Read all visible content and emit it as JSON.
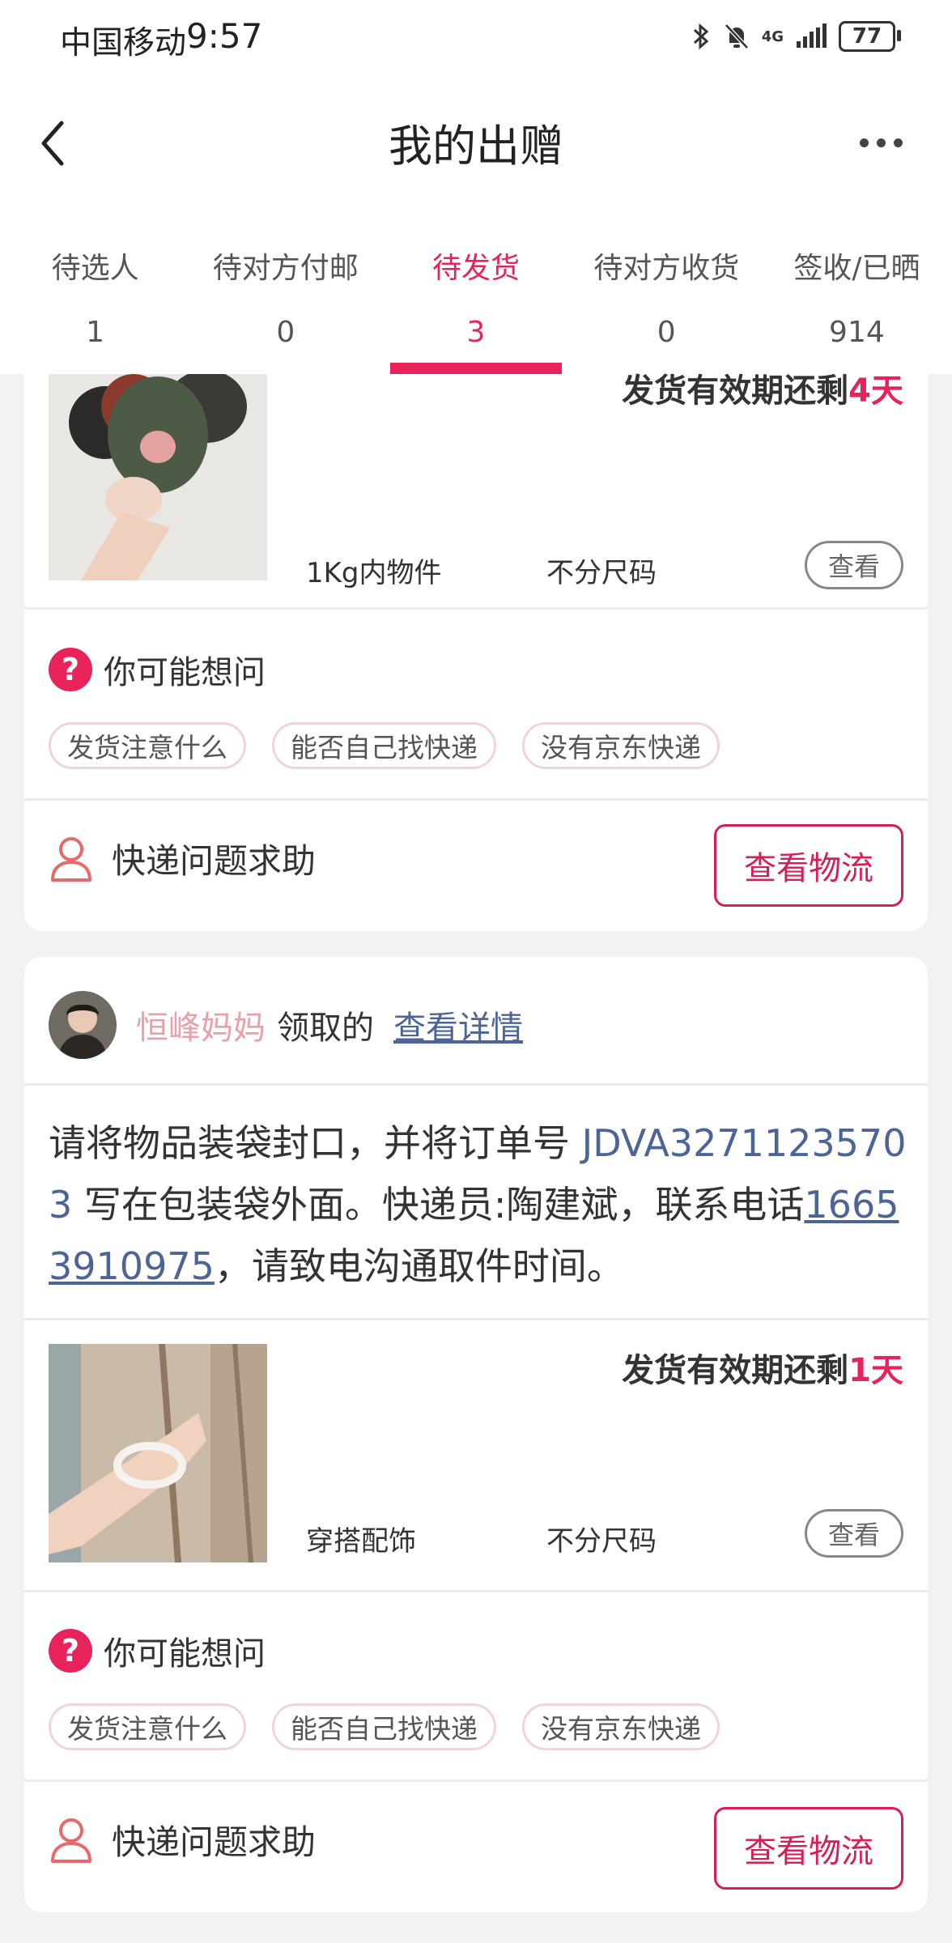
{
  "status_bar": {
    "carrier": "中国移动",
    "time": "9:57",
    "network": "4G",
    "battery": "77",
    "icons": [
      "bluetooth-icon",
      "bell-off-icon",
      "signal-icon",
      "battery-icon"
    ]
  },
  "header": {
    "title": "我的出赠",
    "back_icon": "chevron-left-icon",
    "more_icon": "more-horizontal-icon"
  },
  "tabs": [
    {
      "label": "待选人",
      "count": "1"
    },
    {
      "label": "待对方付邮",
      "count": "0"
    },
    {
      "label": "待发货",
      "count": "3",
      "active": true
    },
    {
      "label": "待对方收货",
      "count": "0"
    },
    {
      "label": "签收/已晒",
      "count": "914"
    }
  ],
  "card1": {
    "deadline_prefix": "发货有效期还剩",
    "deadline_days": "4天",
    "category": "1Kg内物件",
    "size": "不分尺码",
    "view_label": "查看",
    "faq_title": "你可能想问",
    "faq_chips": [
      "发货注意什么",
      "能否自己找快递",
      "没有京东快递"
    ],
    "help_label": "快递问题求助",
    "logistics_label": "查看物流"
  },
  "card2": {
    "recipient_name": "恒峰妈妈",
    "recipient_action": "领取的",
    "detail_link": "查看详情",
    "instr_part1": "请将物品装袋封口，并将订单号 ",
    "order_no": "JDVA32711235703",
    "instr_part2": " 写在包装袋外面。快递员:陶建斌，联系电话",
    "phone": "16653910975",
    "instr_part3": "，请致电沟通取件时间。",
    "deadline_prefix": "发货有效期还剩",
    "deadline_days": "1天",
    "category": "穿搭配饰",
    "size": "不分尺码",
    "view_label": "查看",
    "faq_title": "你可能想问",
    "faq_chips": [
      "发货注意什么",
      "能否自己找快递",
      "没有京东快递"
    ],
    "help_label": "快递问题求助",
    "logistics_label": "查看物流"
  },
  "colors": {
    "accent": "#e8225a",
    "link": "#4d6496",
    "recipient_name": "#e8a1a8"
  }
}
